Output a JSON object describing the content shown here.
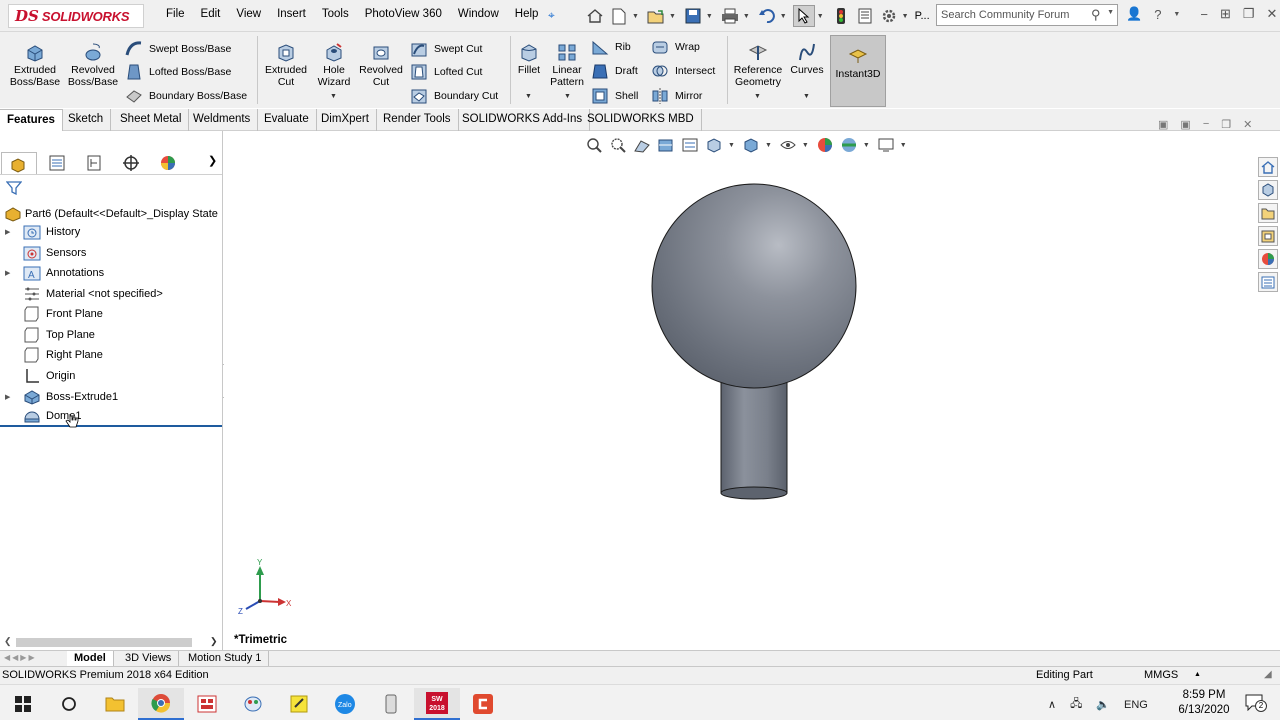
{
  "app": {
    "logo_ds": "DS",
    "logo_brand": "SOLIDWORKS"
  },
  "menu": [
    "File",
    "Edit",
    "View",
    "Insert",
    "Tools",
    "PhotoView 360",
    "Window",
    "Help"
  ],
  "toolbar": {
    "more_label": "P...",
    "search_placeholder": "Search Community Forum"
  },
  "features": {
    "extruded_boss": "Extruded Boss/Base",
    "revolved_boss": "Revolved Boss/Base",
    "swept_boss": "Swept Boss/Base",
    "lofted_boss": "Lofted Boss/Base",
    "boundary_boss": "Boundary Boss/Base",
    "extruded_cut": "Extruded Cut",
    "hole_wizard": "Hole Wizard",
    "revolved_cut": "Revolved Cut",
    "swept_cut": "Swept Cut",
    "lofted_cut": "Lofted Cut",
    "boundary_cut": "Boundary Cut",
    "fillet": "Fillet",
    "linear_pattern": "Linear Pattern",
    "rib": "Rib",
    "draft": "Draft",
    "shell": "Shell",
    "wrap": "Wrap",
    "intersect": "Intersect",
    "mirror": "Mirror",
    "reference_geometry": "Reference Geometry",
    "curves": "Curves",
    "instant3d": "Instant3D"
  },
  "cmd_tabs": [
    "Features",
    "Sketch",
    "Sheet Metal",
    "Weldments",
    "Evaluate",
    "DimXpert",
    "Render Tools",
    "SOLIDWORKS Add-Ins",
    "SOLIDWORKS MBD"
  ],
  "tree": {
    "root": "Part6  (Default<<Default>_Display State",
    "items": [
      {
        "label": "History"
      },
      {
        "label": "Sensors"
      },
      {
        "label": "Annotations"
      },
      {
        "label": "Material <not specified>"
      },
      {
        "label": "Front Plane"
      },
      {
        "label": "Top Plane"
      },
      {
        "label": "Right Plane"
      },
      {
        "label": "Origin"
      },
      {
        "label": "Boss-Extrude1"
      },
      {
        "label": "Dome1"
      }
    ]
  },
  "viewport": {
    "view_name": "*Trimetric",
    "axis_x": "X",
    "axis_y": "Y",
    "axis_z": "Z",
    "body_color": "#7d8491",
    "edge_color": "#1a1a1a"
  },
  "model_tabs": [
    "Model",
    "3D Views",
    "Motion Study 1"
  ],
  "status": {
    "edition": "SOLIDWORKS Premium 2018 x64 Edition",
    "editing": "Editing Part",
    "units": "MMGS"
  },
  "taskbar": {
    "sw_label": "2018",
    "lang": "ENG",
    "time": "8:59 PM",
    "date": "6/13/2020",
    "notif_count": "2"
  },
  "colors": {
    "brand_red": "#c8102e",
    "accent_blue": "#2f6fd1",
    "selection_blue": "#1e5b9e"
  }
}
